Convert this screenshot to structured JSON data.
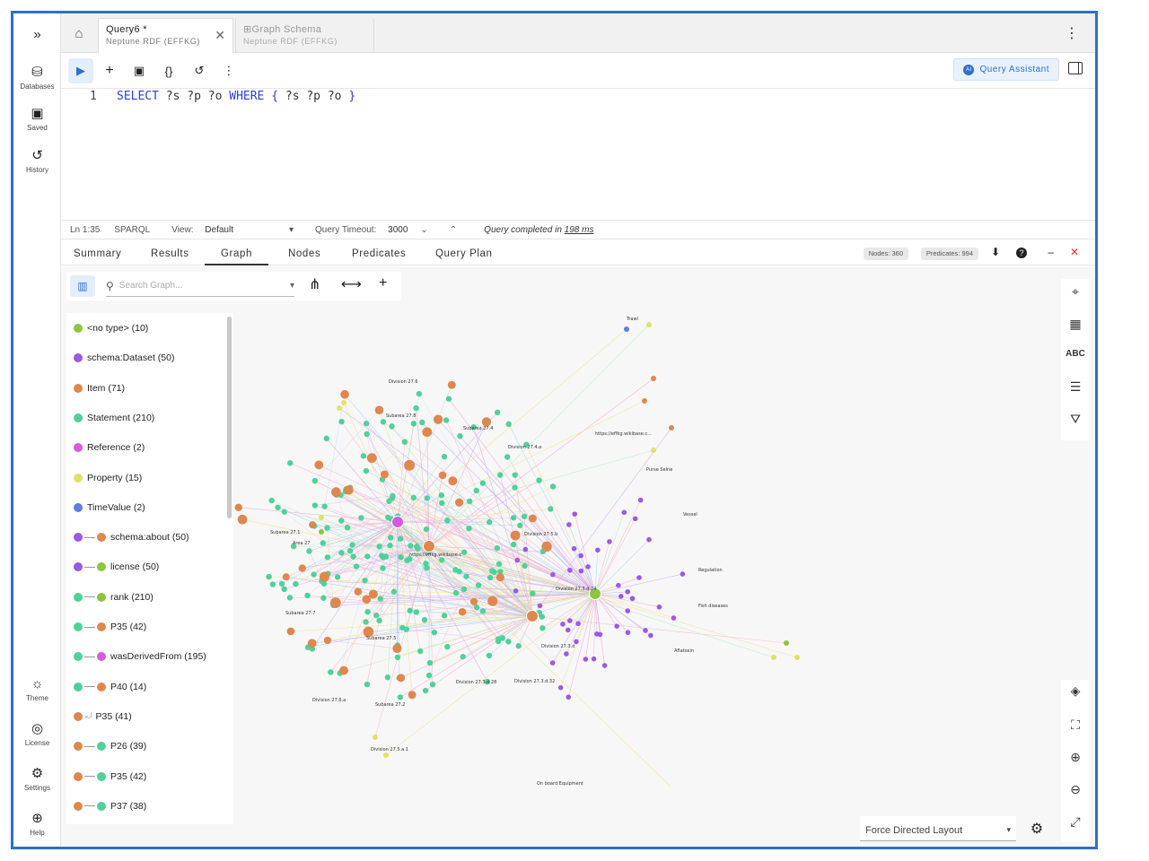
{
  "left_nav": {
    "items": [
      {
        "label": "Databases",
        "icon": "database-icon"
      },
      {
        "label": "Saved",
        "icon": "save-icon"
      },
      {
        "label": "History",
        "icon": "history-icon"
      }
    ],
    "bottom_items": [
      {
        "label": "Theme",
        "icon": "sun-icon"
      },
      {
        "label": "License",
        "icon": "license-icon"
      },
      {
        "label": "Settings",
        "icon": "gear-icon"
      },
      {
        "label": "Help",
        "icon": "help-icon"
      }
    ]
  },
  "tabs": [
    {
      "title": "Query6 *",
      "subtitle": "Neptune RDF (EFFKG)"
    },
    {
      "title": "Graph Schema",
      "subtitle": "Neptune RDF (EFFKG)"
    }
  ],
  "toolbar": {
    "query_assistant": "Query Assistant"
  },
  "editor": {
    "line_number": "1",
    "code_select": "SELECT",
    "code_vars": " ?s ?p ?o ",
    "code_where": "WHERE",
    "code_brace_open": " { ",
    "code_body": "?s ?p ?o",
    "code_brace_close": " }"
  },
  "status": {
    "position": "Ln 1:35",
    "language": "SPARQL",
    "view_label": "View:",
    "view_value": "Default",
    "timeout_label": "Query Timeout:",
    "timeout_value": "3000",
    "message_prefix": "Query completed in",
    "message_time": "198 ms"
  },
  "result_tabs": [
    "Summary",
    "Results",
    "Graph",
    "Nodes",
    "Predicates",
    "Query Plan"
  ],
  "active_tab": "Graph",
  "badges": {
    "nodes": "Nodes: 360",
    "predicates": "Predicates: 994"
  },
  "search": {
    "placeholder": "Search Graph..."
  },
  "legend": [
    {
      "label": "<no type> (10)",
      "c1": "#8cc63f"
    },
    {
      "label": "schema:Dataset (50)",
      "c1": "#9b59e6"
    },
    {
      "label": "Item (71)",
      "c1": "#e0874d"
    },
    {
      "label": "Statement (210)",
      "c1": "#4fd19a"
    },
    {
      "label": "Reference (2)",
      "c1": "#d659e0"
    },
    {
      "label": "Property (15)",
      "c1": "#dde36a"
    },
    {
      "label": "TimeValue (2)",
      "c1": "#5d7fe0"
    },
    {
      "label": "schema:about (50)",
      "c1": "#9b59e6",
      "c2": "#e0874d"
    },
    {
      "label": "license (50)",
      "c1": "#9b59e6",
      "c2": "#8cc63f"
    },
    {
      "label": "rank (210)",
      "c1": "#4fd19a",
      "c2": "#8cc63f"
    },
    {
      "label": "P35 (42)",
      "c1": "#4fd19a",
      "c2": "#e0874d"
    },
    {
      "label": "wasDerivedFrom (195)",
      "c1": "#4fd19a",
      "c2": "#d659e0"
    },
    {
      "label": "P40 (14)",
      "c1": "#4fd19a",
      "c2": "#e0874d"
    },
    {
      "label": "P35 (41)",
      "c1": "#e0874d",
      "loop": true
    },
    {
      "label": "P26 (39)",
      "c1": "#e0874d",
      "c2": "#4fd19a"
    },
    {
      "label": "P35 (42)",
      "c1": "#e0874d",
      "c2": "#4fd19a"
    },
    {
      "label": "P37 (38)",
      "c1": "#e0874d",
      "c2": "#4fd19a"
    }
  ],
  "layout": {
    "value": "Force Directed Layout"
  },
  "graph_labels": [
    "Division 27.6",
    "Subarea 27.8",
    "Subarea 27.4",
    "Division 27.4.a",
    "https://effkg.wikibase.c...",
    "Purse Seine",
    "Vessel",
    "Division 27.5.b",
    "Area 27",
    "Subarea 27.1",
    "Subarea 27.7",
    "https://effkg.wikibase.c",
    "Division 27.3.d.24",
    "Division 27.3.d",
    "Subarea 27.5",
    "Division 27.3.d.28",
    "Division 27.3.d.32",
    "Subarea 27.2",
    "Division 27.6.a",
    "Division 27.5.a.1",
    "On board Equipment",
    "Trawl",
    "Aflatoxin",
    "Fish diseases",
    "Regulation"
  ]
}
